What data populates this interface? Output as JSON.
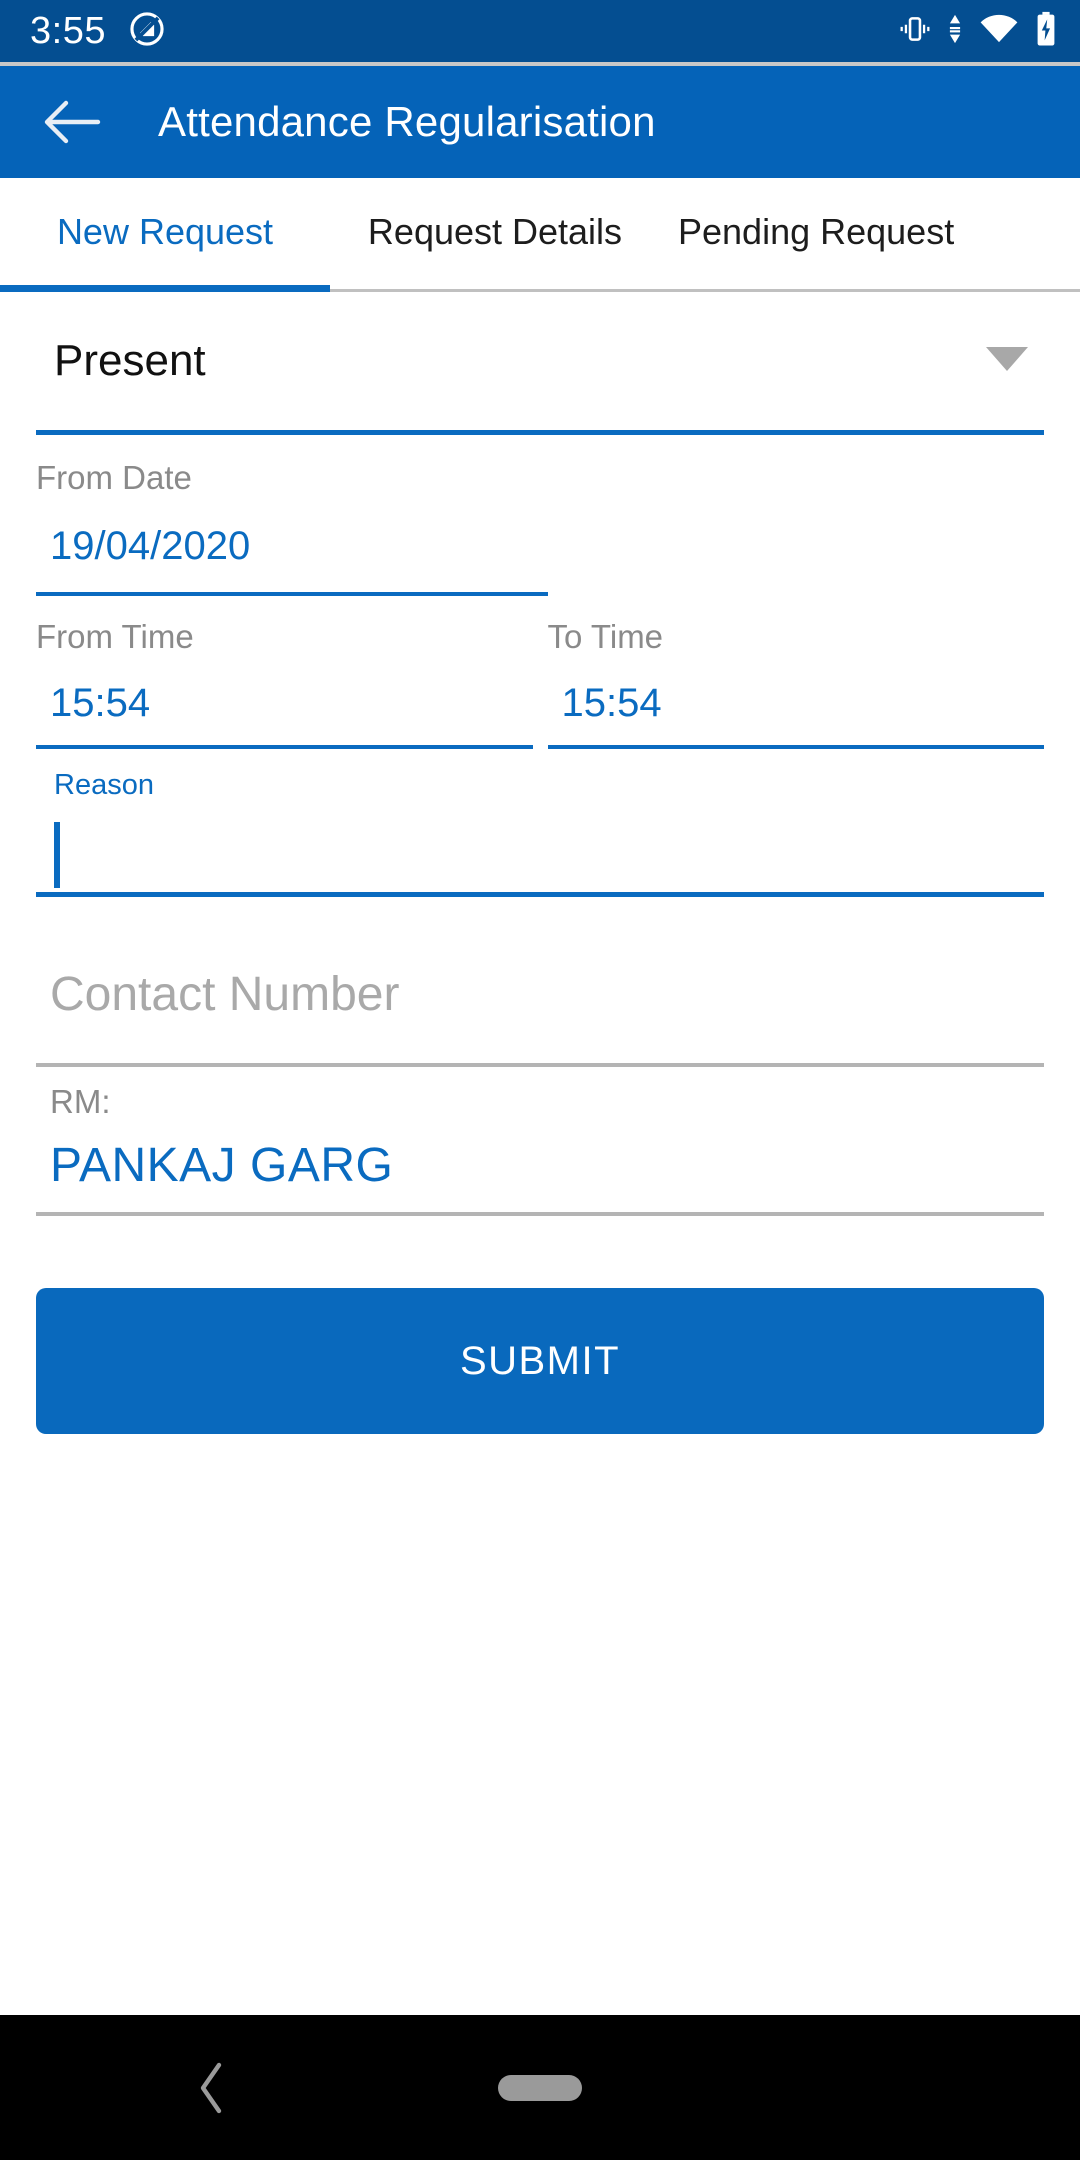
{
  "status_bar": {
    "time": "3:55",
    "left_icons": [
      "do-not-disturb-icon"
    ],
    "right_icons": [
      "vibrate-icon",
      "data-transfer-icon",
      "wifi-icon",
      "battery-charging-icon"
    ],
    "background_color": "#044e91"
  },
  "app_bar": {
    "title": "Attendance Regularisation",
    "back_icon": "back-arrow-icon",
    "background_color": "#0563b8"
  },
  "tabs": {
    "active_index": 0,
    "accent_color": "#0a6bc0",
    "items": [
      {
        "label": "New Request"
      },
      {
        "label": "Request Details"
      },
      {
        "label": "Pending Request"
      }
    ]
  },
  "form": {
    "attendance_type": {
      "value": "Present",
      "caret_icon": "dropdown-caret-icon"
    },
    "from_date": {
      "label": "From Date",
      "value": "19/04/2020"
    },
    "from_time": {
      "label": "From Time",
      "value": "15:54"
    },
    "to_time": {
      "label": "To Time",
      "value": "15:54"
    },
    "reason": {
      "label": "Reason",
      "value": "",
      "focused": true
    },
    "contact_number": {
      "placeholder": "Contact Number",
      "value": ""
    },
    "rm": {
      "label": "RM:",
      "value": "PANKAJ GARG"
    },
    "submit": {
      "label": "SUBMIT",
      "color": "#0969bd"
    }
  },
  "nav_bar": {
    "back_icon": "nav-back-icon",
    "home_icon": "home-pill-icon",
    "background_color": "#000000"
  }
}
